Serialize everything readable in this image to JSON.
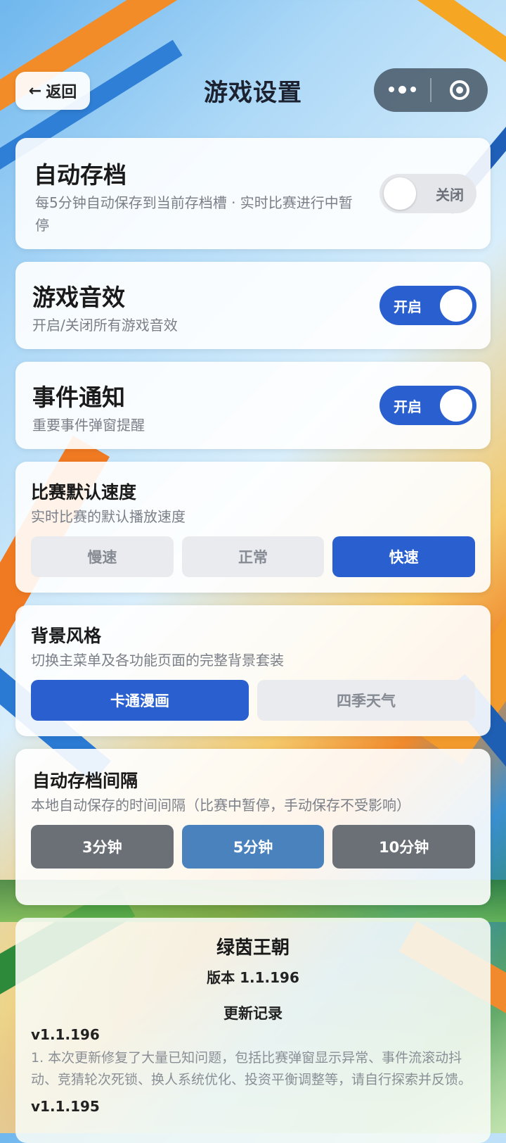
{
  "header": {
    "back_label": "返回",
    "title": "游戏设置"
  },
  "auto_save": {
    "title": "自动存档",
    "desc": "每5分钟自动保存到当前存档槽 · 实时比赛进行中暂停",
    "toggle_label": "关闭",
    "enabled": false
  },
  "sound": {
    "title": "游戏音效",
    "desc": "开启/关闭所有游戏音效",
    "toggle_label": "开启",
    "enabled": true
  },
  "notify": {
    "title": "事件通知",
    "desc": "重要事件弹窗提醒",
    "toggle_label": "开启",
    "enabled": true
  },
  "speed": {
    "title": "比赛默认速度",
    "desc": "实时比赛的默认播放速度",
    "options": [
      "慢速",
      "正常",
      "快速"
    ],
    "selected": "快速"
  },
  "bg_style": {
    "title": "背景风格",
    "desc": "切换主菜单及各功能页面的完整背景套装",
    "options": [
      "卡通漫画",
      "四季天气"
    ],
    "selected": "卡通漫画"
  },
  "save_interval": {
    "title": "自动存档间隔",
    "desc": "本地自动保存的时间间隔（比赛中暂停，手动保存不受影响）",
    "options": [
      "3分钟",
      "5分钟",
      "10分钟"
    ],
    "selected": "5分钟"
  },
  "about": {
    "app_name": "绿茵王朝",
    "version": "版本 1.1.196",
    "changelog_title": "更新记录",
    "entries": [
      {
        "version": "v1.1.196",
        "text": "1. 本次更新修复了大量已知问题，包括比赛弹窗显示异常、事件流滚动抖动、竞猜轮次死锁、换人系统优化、投资平衡调整等，请自行探索并反馈。"
      },
      {
        "version": "v1.1.195"
      }
    ]
  },
  "colors": {
    "accent_blue": "#2a5fd0",
    "steel_blue": "#4a82be",
    "dark_gray": "#6b7077"
  }
}
